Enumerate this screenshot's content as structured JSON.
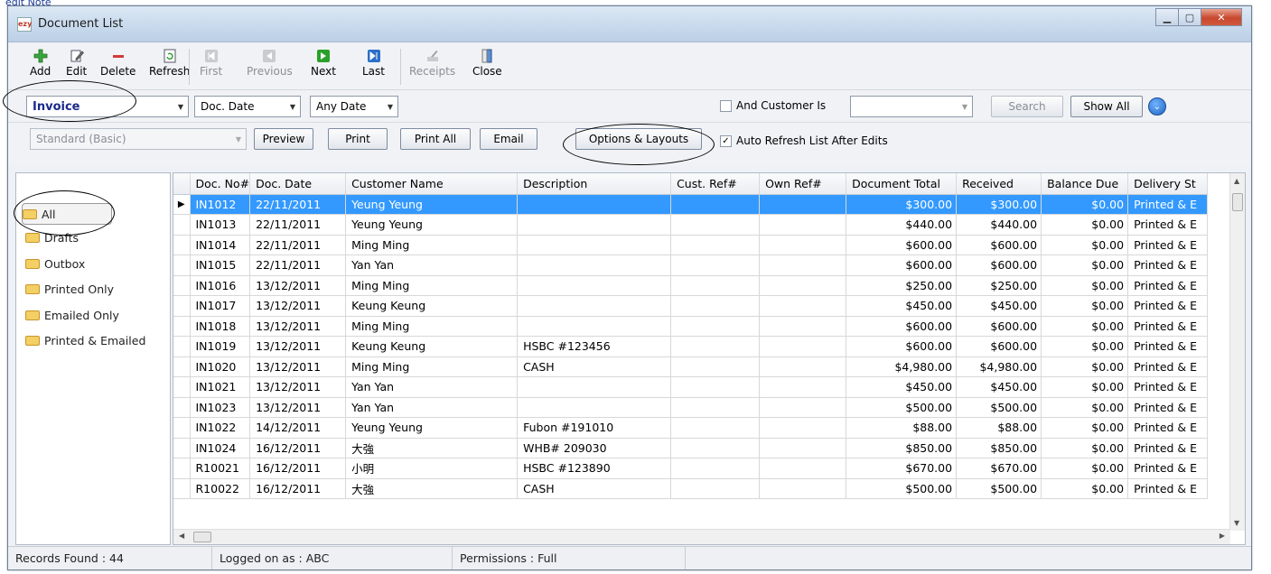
{
  "background": {
    "fragment_text": "edit Note"
  },
  "window": {
    "title": "Document List",
    "icon_text": "ezy"
  },
  "toolbar": {
    "items": [
      {
        "label": "Add",
        "icon": "add-icon"
      },
      {
        "label": "Edit",
        "icon": "edit-icon"
      },
      {
        "label": "Delete",
        "icon": "delete-icon"
      },
      {
        "label": "Refresh",
        "icon": "refresh-icon"
      },
      {
        "label": "First",
        "icon": "first-icon"
      },
      {
        "label": "Previous",
        "icon": "previous-icon"
      },
      {
        "label": "Next",
        "icon": "next-icon"
      },
      {
        "label": "Last",
        "icon": "last-icon"
      },
      {
        "label": "Receipts",
        "icon": "receipts-icon"
      },
      {
        "label": "Close",
        "icon": "close-door-icon"
      }
    ]
  },
  "filters": {
    "doc_type": "Invoice",
    "date_field": "Doc. Date",
    "date_range": "Any Date",
    "and_customer_label": "And Customer Is",
    "customer_value": "",
    "search_label": "Search",
    "show_all_label": "Show All"
  },
  "print_bar": {
    "layout": "Standard (Basic)",
    "preview": "Preview",
    "print": "Print",
    "print_all": "Print All",
    "email": "Email",
    "options_layouts": "Options & Layouts",
    "auto_refresh_label": "Auto Refresh List After Edits",
    "auto_refresh_checked": "✓"
  },
  "sidebar": {
    "folders": [
      "All",
      "Drafts",
      "Outbox",
      "Printed Only",
      "Emailed Only",
      "Printed & Emailed"
    ]
  },
  "grid": {
    "columns": [
      "Doc. No#",
      "Doc. Date",
      "Customer Name",
      "Description",
      "Cust. Ref#",
      "Own Ref#",
      "Document Total",
      "Received",
      "Balance Due",
      "Delivery St"
    ],
    "rows": [
      {
        "doc": "IN1012",
        "date": "22/11/2011",
        "customer": "Yeung Yeung",
        "desc": "",
        "cref": "",
        "oref": "",
        "total": "$300.00",
        "received": "$300.00",
        "balance": "$0.00",
        "delivery": "Printed & E"
      },
      {
        "doc": "IN1013",
        "date": "22/11/2011",
        "customer": "Yeung Yeung",
        "desc": "",
        "cref": "",
        "oref": "",
        "total": "$440.00",
        "received": "$440.00",
        "balance": "$0.00",
        "delivery": "Printed & E"
      },
      {
        "doc": "IN1014",
        "date": "22/11/2011",
        "customer": "Ming Ming",
        "desc": "",
        "cref": "",
        "oref": "",
        "total": "$600.00",
        "received": "$600.00",
        "balance": "$0.00",
        "delivery": "Printed & E"
      },
      {
        "doc": "IN1015",
        "date": "22/11/2011",
        "customer": "Yan Yan",
        "desc": "",
        "cref": "",
        "oref": "",
        "total": "$600.00",
        "received": "$600.00",
        "balance": "$0.00",
        "delivery": "Printed & E"
      },
      {
        "doc": "IN1016",
        "date": "13/12/2011",
        "customer": "Ming Ming",
        "desc": "",
        "cref": "",
        "oref": "",
        "total": "$250.00",
        "received": "$250.00",
        "balance": "$0.00",
        "delivery": "Printed & E"
      },
      {
        "doc": "IN1017",
        "date": "13/12/2011",
        "customer": "Keung Keung",
        "desc": "",
        "cref": "",
        "oref": "",
        "total": "$450.00",
        "received": "$450.00",
        "balance": "$0.00",
        "delivery": "Printed & E"
      },
      {
        "doc": "IN1018",
        "date": "13/12/2011",
        "customer": "Ming Ming",
        "desc": "",
        "cref": "",
        "oref": "",
        "total": "$600.00",
        "received": "$600.00",
        "balance": "$0.00",
        "delivery": "Printed & E"
      },
      {
        "doc": "IN1019",
        "date": "13/12/2011",
        "customer": "Keung Keung",
        "desc": "HSBC #123456",
        "cref": "",
        "oref": "",
        "total": "$600.00",
        "received": "$600.00",
        "balance": "$0.00",
        "delivery": "Printed & E"
      },
      {
        "doc": "IN1020",
        "date": "13/12/2011",
        "customer": "Ming Ming",
        "desc": "CASH",
        "cref": "",
        "oref": "",
        "total": "$4,980.00",
        "received": "$4,980.00",
        "balance": "$0.00",
        "delivery": "Printed & E"
      },
      {
        "doc": "IN1021",
        "date": "13/12/2011",
        "customer": "Yan Yan",
        "desc": "",
        "cref": "",
        "oref": "",
        "total": "$450.00",
        "received": "$450.00",
        "balance": "$0.00",
        "delivery": "Printed & E"
      },
      {
        "doc": "IN1023",
        "date": "13/12/2011",
        "customer": "Yan Yan",
        "desc": "",
        "cref": "",
        "oref": "",
        "total": "$500.00",
        "received": "$500.00",
        "balance": "$0.00",
        "delivery": "Printed & E"
      },
      {
        "doc": "IN1022",
        "date": "14/12/2011",
        "customer": "Yeung Yeung",
        "desc": "Fubon #191010",
        "cref": "",
        "oref": "",
        "total": "$88.00",
        "received": "$88.00",
        "balance": "$0.00",
        "delivery": "Printed & E"
      },
      {
        "doc": "IN1024",
        "date": "16/12/2011",
        "customer": "大強",
        "desc": "WHB# 209030",
        "cref": "",
        "oref": "",
        "total": "$850.00",
        "received": "$850.00",
        "balance": "$0.00",
        "delivery": "Printed & E"
      },
      {
        "doc": "R10021",
        "date": "16/12/2011",
        "customer": "小明",
        "desc": "HSBC #123890",
        "cref": "",
        "oref": "",
        "total": "$670.00",
        "received": "$670.00",
        "balance": "$0.00",
        "delivery": "Printed & E"
      },
      {
        "doc": "R10022",
        "date": "16/12/2011",
        "customer": "大強",
        "desc": "CASH",
        "cref": "",
        "oref": "",
        "total": "$500.00",
        "received": "$500.00",
        "balance": "$0.00",
        "delivery": "Printed & E"
      }
    ]
  },
  "status": {
    "records": "Records Found : 44",
    "logged": "Logged on as : ABC",
    "permissions": "Permissions : Full"
  },
  "colors": {
    "selection": "#3399ff",
    "folder": "#f3cf64",
    "invoice_text": "#1a2a8a"
  }
}
